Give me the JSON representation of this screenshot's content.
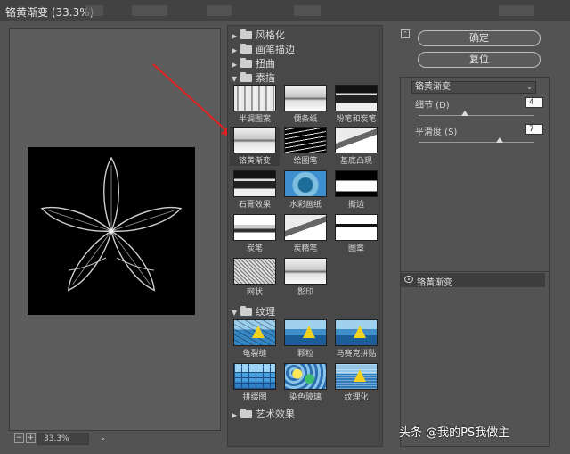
{
  "window": {
    "title": "铬黄渐变 (33.3%)"
  },
  "preview": {
    "zoom": "33.3%",
    "zoom_out": "−",
    "zoom_in": "+",
    "zoom_arrow": "⌄"
  },
  "browser": {
    "top_categories": [
      "风格化",
      "画笔描边",
      "扭曲",
      "素描"
    ],
    "sketch_filters": [
      "半调图案",
      "便条纸",
      "粉笔和炭笔",
      "铬黄渐变",
      "绘图笔",
      "基底凸现",
      "石膏效果",
      "水彩画纸",
      "撕边",
      "炭笔",
      "炭精笔",
      "图章",
      "网状",
      "影印"
    ],
    "texture_category": "纹理",
    "texture_filters": [
      "龟裂缝",
      "颗粒",
      "马赛克拼贴",
      "拼缀图",
      "染色玻璃",
      "纹理化"
    ],
    "artistic_category": "艺术效果",
    "selected_filter": "铬黄渐变"
  },
  "panel": {
    "ok": "确定",
    "reset": "复位",
    "filter_select": "铬黄渐变",
    "params": [
      {
        "label": "细节 (D)",
        "value": "4",
        "level": 0.4
      },
      {
        "label": "平滑度 (S)",
        "value": "7",
        "level": 0.7
      }
    ],
    "layer_name": "铬黄渐变"
  },
  "watermark": "头条 @我的PS我做主"
}
